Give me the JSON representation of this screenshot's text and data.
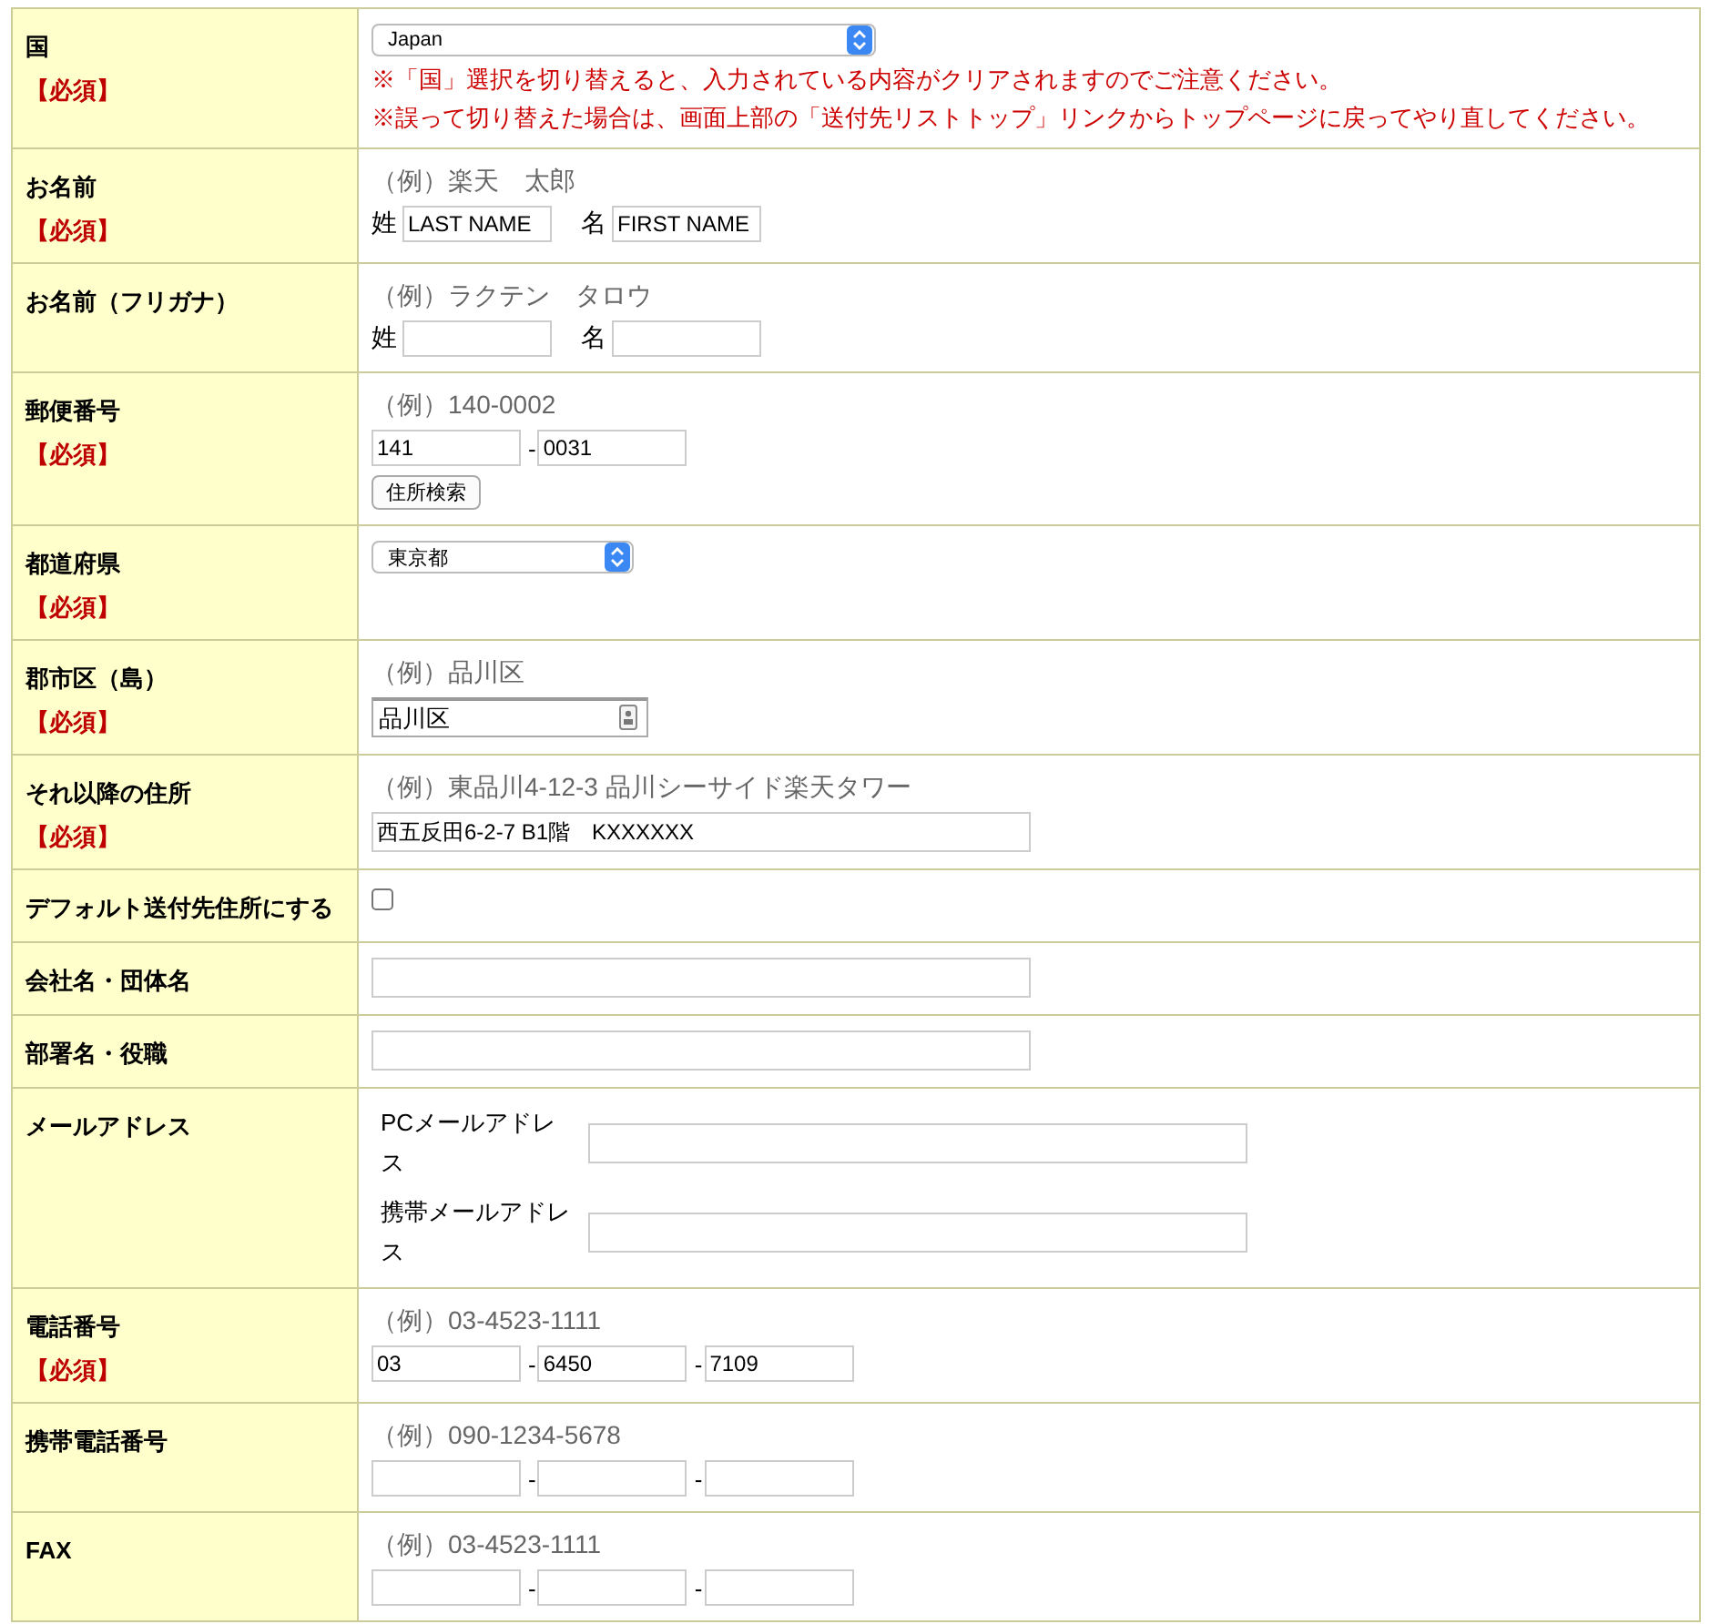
{
  "rows": [
    {
      "label": "国",
      "required": "【必須】",
      "kind": "select",
      "value": "Japan",
      "notes": [
        "※「国」選択を切り替えると、入力されている内容がクリアされますのでご注意ください。",
        "※誤って切り替えた場合は、画面上部の「送付先リストトップ」リンクからトップページに戻ってやり直してください。"
      ]
    },
    {
      "label": "お名前",
      "required": "【必須】",
      "kind": "pair",
      "example": "（例）楽天　太郎",
      "parts": [
        {
          "label": "姓",
          "value": "LAST NAME"
        },
        {
          "label": "名",
          "value": "FIRST NAME"
        }
      ]
    },
    {
      "label": "お名前（フリガナ）",
      "kind": "pair",
      "example": "（例）ラクテン　タロウ",
      "parts": [
        {
          "label": "姓"
        },
        {
          "label": "名"
        }
      ]
    },
    {
      "label": "郵便番号",
      "required": "【必須】",
      "kind": "split",
      "example": "（例）140-0002",
      "parts": [
        {
          "value": "141"
        },
        {
          "value": "0031"
        }
      ],
      "separator": "-",
      "button": "住所検索"
    },
    {
      "label": "都道府県",
      "required": "【必須】",
      "kind": "select",
      "value": "東京都"
    },
    {
      "label": "郡市区（島）",
      "required": "【必須】",
      "kind": "city",
      "example": "（例）品川区",
      "value": "品川区"
    },
    {
      "label": "それ以降の住所",
      "required": "【必須】",
      "kind": "text",
      "example": "（例）東品川4-12-3 品川シーサイド楽天タワー",
      "value": "西五反田6-2-7 B1階　KXXXXXX"
    },
    {
      "label": "デフォルト送付先住所にする",
      "kind": "checkbox",
      "checked": false
    },
    {
      "label": "会社名・団体名",
      "kind": "text"
    },
    {
      "label": "部署名・役職",
      "kind": "text"
    },
    {
      "label": "メールアドレス",
      "kind": "email",
      "fields": [
        {
          "label": "PCメールアドレス"
        },
        {
          "label": "携帯メールアドレス"
        }
      ]
    },
    {
      "label": "電話番号",
      "required": "【必須】",
      "kind": "split",
      "example": "（例）03-4523-1111",
      "parts": [
        {
          "value": "03"
        },
        {
          "value": "6450"
        },
        {
          "value": "7109"
        }
      ],
      "separator": "-"
    },
    {
      "label": "携帯電話番号",
      "kind": "split",
      "example": "（例）090-1234-5678",
      "parts": [
        {
          "kind": "blank"
        },
        {
          "kind": "blank"
        },
        {
          "kind": "blank"
        }
      ],
      "separator": "-"
    },
    {
      "label": "FAX",
      "kind": "split",
      "example": "（例）03-4523-1111",
      "parts": [
        {
          "kind": "blank"
        },
        {
          "kind": "blank"
        },
        {
          "kind": "blank"
        }
      ],
      "separator": "-"
    }
  ]
}
